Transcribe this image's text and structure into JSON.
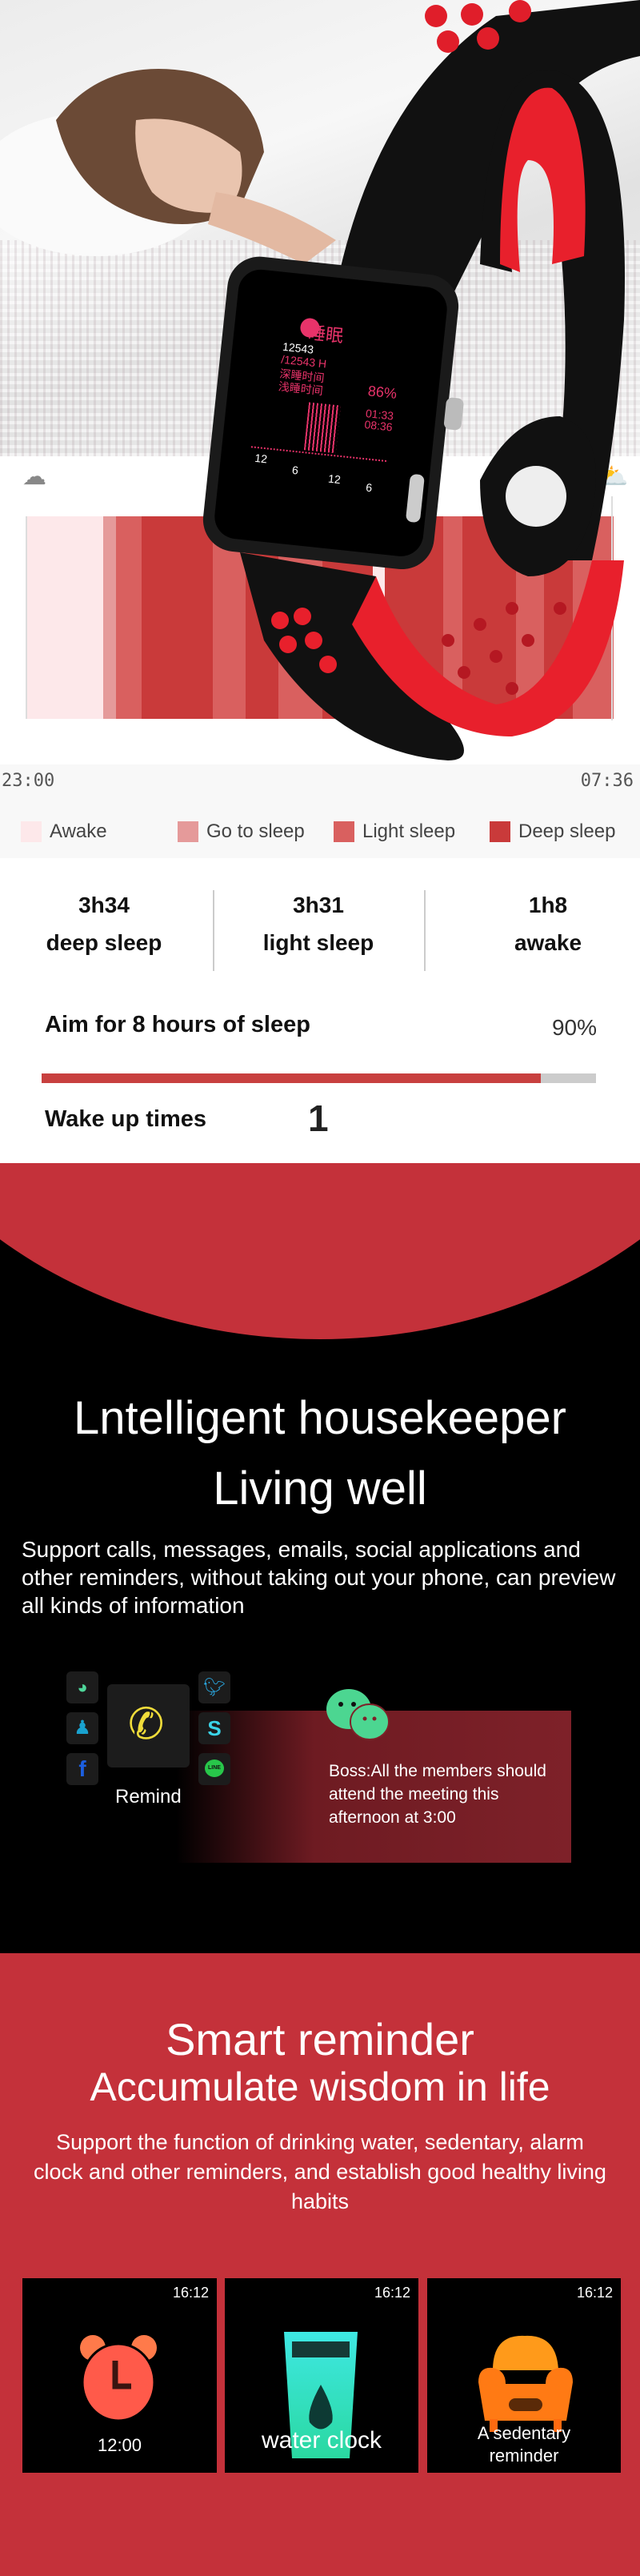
{
  "watch_screen": {
    "title": "睡眠",
    "steps": "12543",
    "steps_total": "/12543 H",
    "deep_label": "深睡时间",
    "light_label": "浅睡时间",
    "percent": "86%",
    "start": "01:33",
    "end": "08:36",
    "axis": [
      "12",
      "6",
      "12",
      "6"
    ]
  },
  "chart_data": {
    "type": "bar",
    "title": "",
    "xlabel": "",
    "ylabel": "",
    "x_range": [
      "23:00",
      "07:36"
    ],
    "segments": [
      {
        "stage": "Awake",
        "start": "23:00",
        "end": "00:07"
      },
      {
        "stage": "Go to sleep",
        "start": "00:07",
        "end": "00:18"
      },
      {
        "stage": "Light sleep",
        "start": "00:18",
        "end": "00:41"
      },
      {
        "stage": "Deep sleep",
        "start": "00:41",
        "end": "01:43"
      },
      {
        "stage": "Light sleep",
        "start": "01:43",
        "end": "02:12"
      },
      {
        "stage": "Deep sleep",
        "start": "02:12",
        "end": "02:41"
      },
      {
        "stage": "Light sleep",
        "start": "02:41",
        "end": "03:20"
      },
      {
        "stage": "Deep sleep",
        "start": "03:20",
        "end": "04:04"
      },
      {
        "stage": "Awake",
        "start": "04:04",
        "end": "04:15"
      },
      {
        "stage": "Deep sleep",
        "start": "04:15",
        "end": "05:06"
      },
      {
        "stage": "Light sleep",
        "start": "05:06",
        "end": "05:23"
      },
      {
        "stage": "Deep sleep",
        "start": "05:23",
        "end": "06:10"
      },
      {
        "stage": "Light sleep",
        "start": "06:10",
        "end": "06:35"
      },
      {
        "stage": "Deep sleep",
        "start": "06:35",
        "end": "07:00"
      },
      {
        "stage": "Light sleep",
        "start": "07:00",
        "end": "07:36"
      }
    ],
    "legend": [
      {
        "label": "Awake",
        "color": "#fde8ea"
      },
      {
        "label": "Go to sleep",
        "color": "#e59a9a"
      },
      {
        "label": "Light sleep",
        "color": "#d9605f"
      },
      {
        "label": "Deep sleep",
        "color": "#c93a3a"
      }
    ],
    "legend_position": "bottom"
  },
  "chart_labels": {
    "start": "23:00",
    "end": "07:36",
    "left_icon": "cloud-moon-icon",
    "right_icon": "cloud-sun-icon"
  },
  "stats": [
    {
      "value": "3h34",
      "label": "deep sleep"
    },
    {
      "value": "3h31",
      "label": "light sleep"
    },
    {
      "value": "1h8",
      "label": "awake"
    }
  ],
  "aim": {
    "label": "Aim for 8 hours of sleep",
    "percent_text": "90%",
    "progress": 90,
    "fill_color": "#c8403f",
    "track_color": "#cccccc"
  },
  "wake": {
    "label": "Wake up times",
    "value": "1"
  },
  "section1": {
    "title1": "Lntelligent housekeeper",
    "title2": "Living well",
    "desc": "Support calls, messages, emails, social applications and other reminders, without taking out your phone, can preview all kinds of information",
    "apps_left": [
      "wechat-icon",
      "qq-icon",
      "facebook-icon"
    ],
    "apps_right": [
      "twitter-icon",
      "skype-icon",
      "line-icon"
    ],
    "line_text": "LINE",
    "remind": "Remind",
    "message": "Boss:All the members should attend the meeting this afternoon at 3:00"
  },
  "section2": {
    "title1": "Smart reminder",
    "title2": "Accumulate wisdom in life",
    "desc": "Support the function of drinking water, sedentary, alarm clock and other reminders, and establish good healthy living habits",
    "cards": [
      {
        "time": "16:12",
        "label": "12:00",
        "icon": "alarm-clock-icon"
      },
      {
        "time": "16:12",
        "label": "water clock",
        "icon": "water-glass-icon"
      },
      {
        "time": "16:12",
        "label": "A sedentary reminder",
        "icon": "armchair-icon"
      }
    ]
  },
  "colors": {
    "brand_red": "#c4313a",
    "black": "#000000"
  }
}
